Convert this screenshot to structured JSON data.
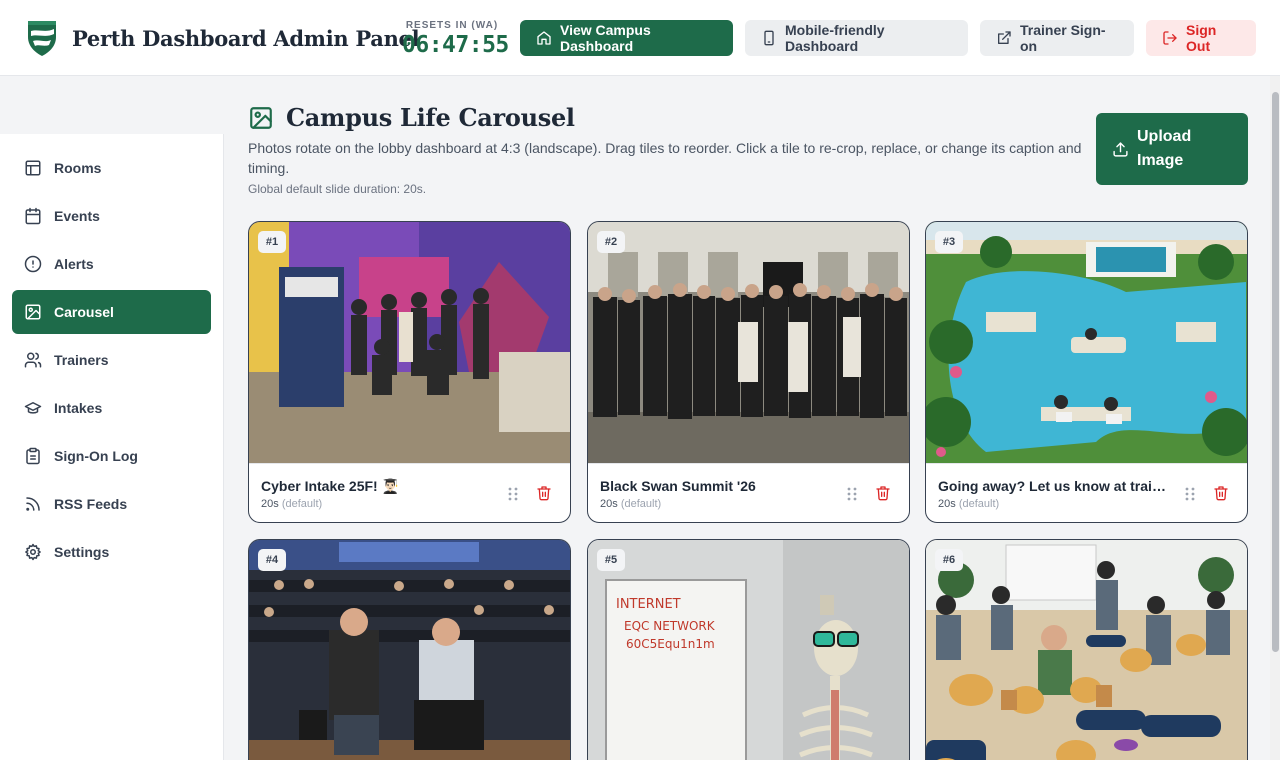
{
  "header": {
    "title": "Perth Dashboard Admin Panel",
    "timer_label": "RESETS IN (WA)",
    "timer_value": "06:47:55",
    "buttons": {
      "campus": "View Campus Dashboard",
      "mobile": "Mobile-friendly Dashboard",
      "trainer": "Trainer Sign-on",
      "signout": "Sign Out"
    }
  },
  "sidebar": {
    "items": [
      {
        "label": "Rooms",
        "icon": "layout-icon"
      },
      {
        "label": "Events",
        "icon": "calendar-icon"
      },
      {
        "label": "Alerts",
        "icon": "alert-circle-icon"
      },
      {
        "label": "Carousel",
        "icon": "image-icon",
        "active": true
      },
      {
        "label": "Trainers",
        "icon": "users-icon"
      },
      {
        "label": "Intakes",
        "icon": "graduation-cap-icon"
      },
      {
        "label": "Sign-On Log",
        "icon": "clipboard-icon"
      },
      {
        "label": "RSS Feeds",
        "icon": "rss-icon"
      },
      {
        "label": "Settings",
        "icon": "gear-icon"
      }
    ]
  },
  "main": {
    "title": "Campus Life Carousel",
    "description": "Photos rotate on the lobby dashboard at 4:3 (landscape). Drag tiles to reorder. Click a tile to re-crop, replace, or change its caption and timing.",
    "global_default": "Global default slide duration: 20s.",
    "upload_label_line1": "Upload",
    "upload_label_line2": "Image"
  },
  "slides": [
    {
      "num": "#1",
      "caption": "Cyber Intake 25F! 👨🏻‍🎓",
      "duration": "20s",
      "default_label": "(default)"
    },
    {
      "num": "#2",
      "caption": "Black Swan Summit '26",
      "duration": "20s",
      "default_label": "(default)"
    },
    {
      "num": "#3",
      "caption": "Going away? Let us know at trainer...",
      "duration": "20s",
      "default_label": "(default)"
    },
    {
      "num": "#4"
    },
    {
      "num": "#5"
    },
    {
      "num": "#6"
    }
  ],
  "colors": {
    "accent": "#1e6b4a",
    "danger": "#dc2626",
    "danger_bg": "#fde8e8"
  }
}
